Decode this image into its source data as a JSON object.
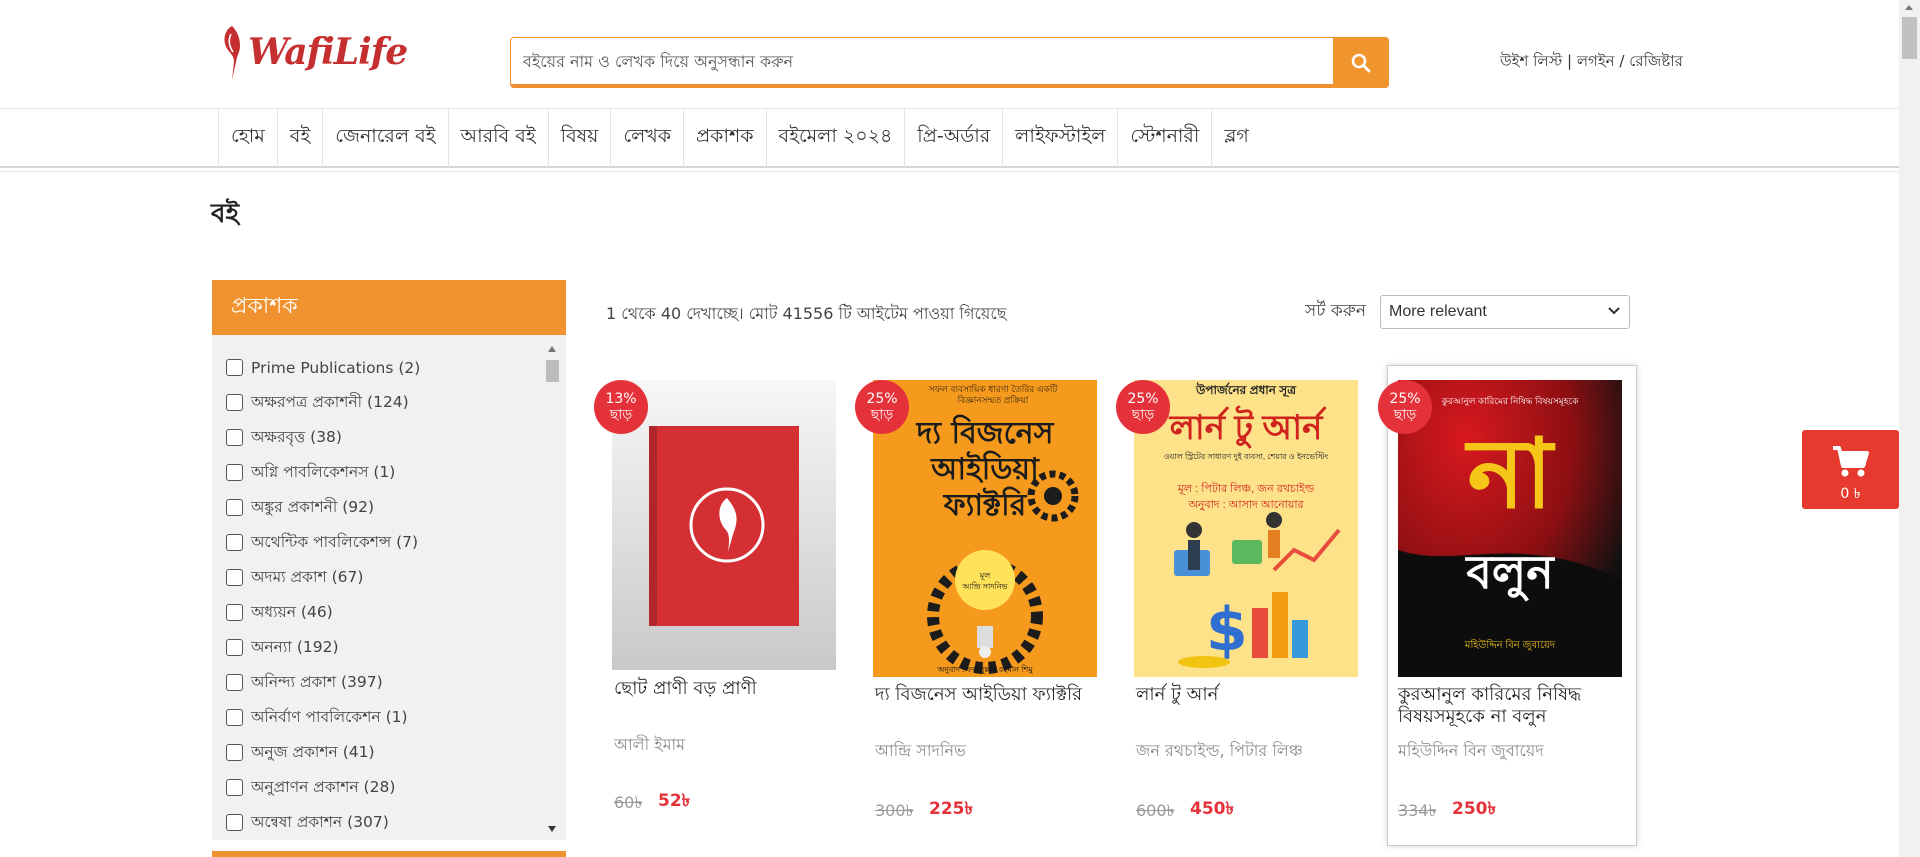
{
  "header": {
    "logo_text": "WafiLife",
    "search_placeholder": "বইয়ের নাম ও লেখক দিয়ে অনুসন্ধান করুন",
    "wishlist": "উইশ লিস্ট",
    "login": "লগইন",
    "register": "রেজিষ্টার",
    "link_sep": "|",
    "slash": "/"
  },
  "nav": {
    "items": [
      "হোম",
      "বই",
      "জেনারেল বই",
      "আরবি বই",
      "বিষয়",
      "লেখক",
      "প্রকাশক",
      "বইমেলা ২০২৪",
      "প্রি-অর্ডার",
      "লাইফস্টাইল",
      "স্টেশনারী",
      "ব্লগ"
    ]
  },
  "page": {
    "title": "বই"
  },
  "sidebar": {
    "heading": "প্রকাশক",
    "publishers": [
      "Prime Publications (2)",
      "অক্ষরপত্র প্রকাশনী (124)",
      "অক্ষরবৃত্ত (38)",
      "অগ্নি পাবলিকেশনস (1)",
      "অঙ্কুর প্রকাশনী (92)",
      "অথেন্টিক পাবলিকেশন্স (7)",
      "অদম্য প্রকাশ (67)",
      "অধ্যয়ন (46)",
      "অনন্যা (192)",
      "অনিন্দ্য প্রকাশ (397)",
      "অনির্বাণ পাবলিকেশন (1)",
      "অনুজ প্রকাশন (41)",
      "অনুপ্রাণন প্রকাশন (28)",
      "অন্বেষা প্রকাশন (307)"
    ]
  },
  "results": {
    "count_text": "1 থেকে 40 দেখাচ্ছে। মোট 41556 টি আইটেম পাওয়া গিয়েছে",
    "sort_label": "সর্ট করুন",
    "sort_selected": "More relevant"
  },
  "products": [
    {
      "discount": "13%",
      "off": "ছাড়",
      "title": "ছোট প্রাণী বড় প্রাণী",
      "author": "আলী ইমাম",
      "old_price": "60৳",
      "new_price": "52৳"
    },
    {
      "discount": "25%",
      "off": "ছাড়",
      "title": "দ্য বিজনেস আইডিয়া ফ্যাক্টরি",
      "author": "আন্দ্রি সাদনিভ",
      "old_price": "300৳",
      "new_price": "225৳",
      "cover": {
        "top": "সফল ব্যবসায়িক ধারণা তৈরির একটি বিজ্ঞানসম্মত প্রক্রিয়া",
        "title_lines": [
          "দ্য বিজনেস",
          "আইডিয়া",
          "ফ্যাক্টরি"
        ],
        "by": "মূল",
        "author": "আন্দ্রি সাদনিভ",
        "translator": "অনুবাদ : ফয়জুল্লাহ রহমান শিমু"
      }
    },
    {
      "discount": "25%",
      "off": "ছাড়",
      "title": "লার্ন টু আর্ন",
      "author": "জন রথচাইল্ড, পিটার লিঞ্চ",
      "old_price": "600৳",
      "new_price": "450৳",
      "cover": {
        "top": "উপার্জনের প্রধান সূত্র",
        "title": "লার্ন টু আর্ন",
        "sub1": "ওয়াল স্ট্রিটের সাধারণ দুই ব্যবসা, শেয়ার ও ইনভেস্টিং",
        "sub2": "মূল : পিটার লিঞ্চ, জন রথচাইল্ড",
        "sub3": "অনুবাদ : আসাদ আনোয়ার"
      }
    },
    {
      "discount": "25%",
      "off": "ছাড়",
      "title": "কুরআনুল কারিমের নিষিদ্ধ বিষয়সমূহকে না বলুন",
      "author": "মহিউদ্দিন বিন জুবায়েদ",
      "old_price": "334৳",
      "new_price": "250৳",
      "cover": {
        "top": "কুরআনুল কারিমের নিষিদ্ধ বিষয়সমূহকে",
        "big": "না",
        "word": "বলুন",
        "author": "মহিউদ্দিন বিন জুবায়েদ"
      }
    }
  ],
  "cart": {
    "count": "0 ৳"
  },
  "colors": {
    "accent": "#f0942e",
    "brand_red": "#e5323a",
    "logo_red": "#c62f2f"
  }
}
